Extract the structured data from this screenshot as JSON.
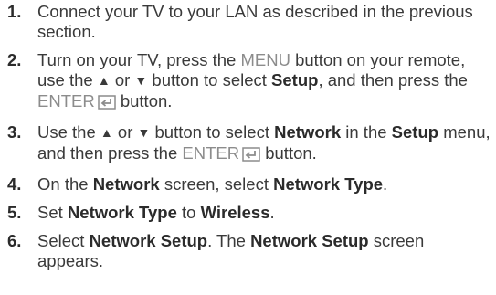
{
  "steps": [
    {
      "num": "1.",
      "text": "Connect your TV to your LAN as described in the previous section."
    },
    {
      "num": "2.",
      "t1": "Turn on your TV, press the ",
      "menu": "MENU",
      "t2": " button on your remote, use the ",
      "up": "▲",
      "t3": " or ",
      "down": "▼",
      "t4": " button to select ",
      "setup": "Setup",
      "t5": ", and then press the ",
      "enter": "ENTER",
      "t6": " button."
    },
    {
      "num": "3.",
      "t1": "Use the ",
      "up": "▲",
      "t2": " or ",
      "down": "▼",
      "t3": " button to select ",
      "network": "Network",
      "t4": " in the ",
      "setup": "Setup",
      "t5": " menu, and then press the ",
      "enter": "ENTER",
      "t6": " button."
    },
    {
      "num": "4.",
      "t1": "On the ",
      "network": "Network",
      "t2": " screen, select ",
      "network_type": "Network Type",
      "t3": "."
    },
    {
      "num": "5.",
      "t1": "Set ",
      "network_type": "Network Type",
      "t2": " to ",
      "wireless": "Wireless",
      "t3": "."
    },
    {
      "num": "6.",
      "t1": "Select ",
      "network_setup": "Network Setup",
      "t2": ". The ",
      "network_setup_2": "Network Setup",
      "t3": " screen appears."
    }
  ],
  "icons": {
    "enter": "enter-return-icon"
  },
  "colors": {
    "text": "#3a3a3a",
    "button_label": "#8c8c8c"
  }
}
